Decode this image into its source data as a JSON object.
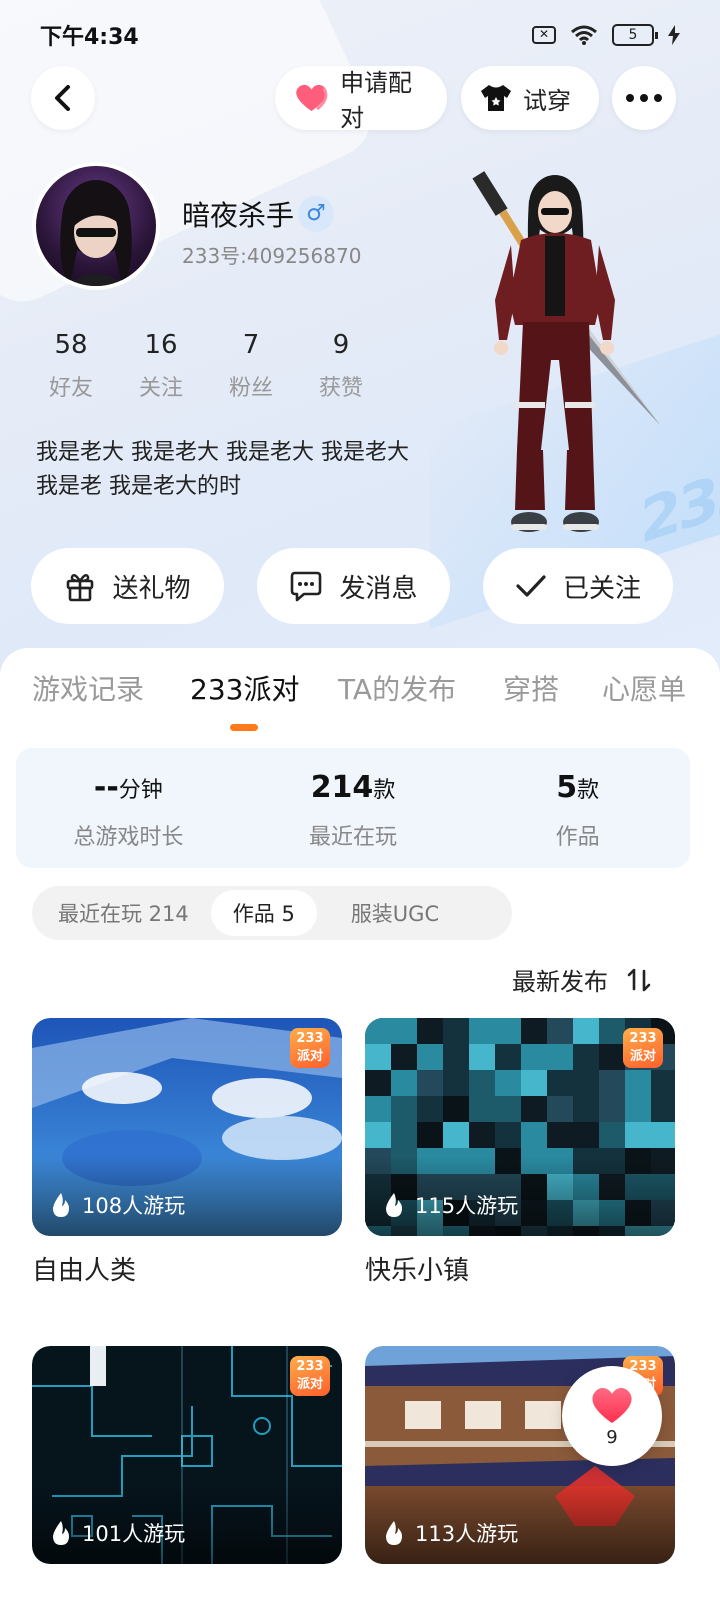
{
  "status_bar": {
    "time": "下午4:34",
    "battery": "5"
  },
  "top_actions": {
    "pair_label": "申请配对",
    "tryon_label": "试穿"
  },
  "profile": {
    "username": "暗夜杀手",
    "gender_symbol": "♂",
    "user_id": "233号:409256870",
    "stats": [
      {
        "value": "58",
        "label": "好友"
      },
      {
        "value": "16",
        "label": "关注"
      },
      {
        "value": "7",
        "label": "粉丝"
      },
      {
        "value": "9",
        "label": "获赞"
      }
    ],
    "bio_line1": "我是老大 我是老大 我是老大 我是老大",
    "bio_line2": "我是老 我是老大的时"
  },
  "actions": {
    "gift_label": "送礼物",
    "message_label": "发消息",
    "follow_label": "已关注"
  },
  "tabs": [
    "游戏记录",
    "233派对",
    "TA的发布",
    "穿搭",
    "心愿单"
  ],
  "active_tab": "233派对",
  "summary": [
    {
      "value": "--",
      "unit": "分钟",
      "label": "总游戏时长"
    },
    {
      "value": "214",
      "unit": "款",
      "label": "最近在玩"
    },
    {
      "value": "5",
      "unit": "款",
      "label": "作品"
    }
  ],
  "filters": [
    "最近在玩 214",
    "作品 5",
    "服装UGC"
  ],
  "active_filter": "作品 5",
  "sort_label": "最新发布",
  "badge_text": {
    "line1": "233",
    "line2": "派对"
  },
  "works": [
    {
      "title": "自由人类",
      "plays": "108人游玩"
    },
    {
      "title": "快乐小镇",
      "plays": "115人游玩"
    },
    {
      "title": "",
      "plays": "101人游玩"
    },
    {
      "title": "",
      "plays": "113人游玩"
    }
  ],
  "like_count": "9",
  "colors": {
    "accent": "#ff7a1a",
    "heart": "#ff4d6d",
    "summary_bg": "#f1f6fd"
  }
}
